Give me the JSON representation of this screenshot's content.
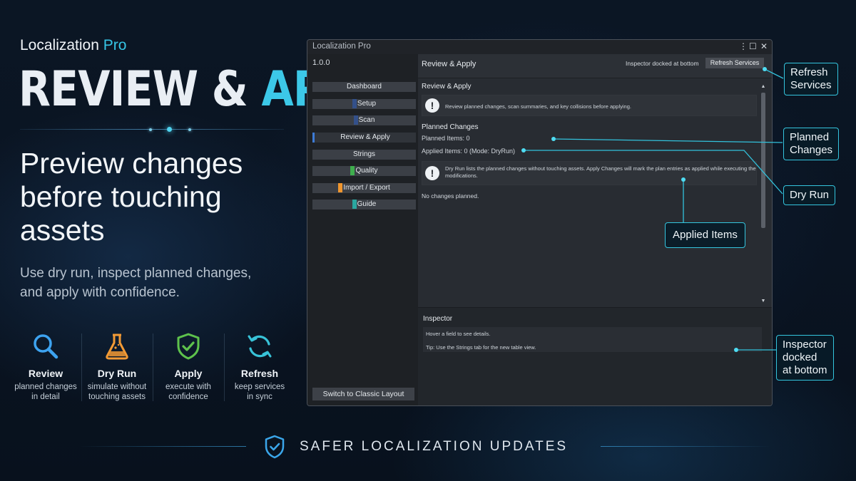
{
  "hero": {
    "brand_name": "Localization",
    "brand_accent": "Pro",
    "title_part1": "REVIEW &",
    "title_part2": "APPLY",
    "headline": "Preview changes before touching assets",
    "subline": "Use dry run, inspect planned changes, and apply with confidence."
  },
  "features": [
    {
      "icon": "magnifier-icon",
      "title": "Review",
      "desc1": "planned changes",
      "desc2": "in detail",
      "color": "#3da3f0"
    },
    {
      "icon": "flask-icon",
      "title": "Dry Run",
      "desc1": "simulate without",
      "desc2": "touching assets",
      "color": "#f29a35"
    },
    {
      "icon": "shield-check-icon",
      "title": "Apply",
      "desc1": "execute with",
      "desc2": "confidence",
      "color": "#5ec24c"
    },
    {
      "icon": "refresh-icon",
      "title": "Refresh",
      "desc1": "keep services",
      "desc2": "in sync",
      "color": "#38c3d8"
    }
  ],
  "footer": {
    "text": "SAFER LOCALIZATION UPDATES",
    "icon": "shield-check-icon"
  },
  "window": {
    "title": "Localization Pro",
    "controls": [
      "⋮",
      "☐",
      "✕"
    ],
    "version": "1.0.0",
    "nav": [
      {
        "label": "Dashboard",
        "marker": ""
      },
      {
        "label": "Setup",
        "marker": "#33508a"
      },
      {
        "label": "Scan",
        "marker": "#33508a"
      },
      {
        "label": "Review & Apply",
        "marker": "",
        "active": true
      },
      {
        "label": "Strings",
        "marker": ""
      },
      {
        "label": "Quality",
        "marker": "#3fae4e"
      },
      {
        "label": "Import / Export",
        "marker": "#f0962e"
      },
      {
        "label": "Guide",
        "marker": "#2aa7a0"
      }
    ],
    "classic_button": "Switch to Classic Layout",
    "header_title": "Review & Apply",
    "dock_note": "Inspector docked at bottom",
    "refresh_button": "Refresh Services",
    "section_title": "Review & Apply",
    "intro_message": "Review planned changes, scan summaries, and key collisions before applying.",
    "planned_title": "Planned Changes",
    "planned_items": "Planned Items: 0",
    "applied_items": "Applied Items: 0 (Mode: DryRun)",
    "dryrun_line1": "Dry Run lists the planned changes without touching assets. Apply Changes will mark the plan entries as applied while executing the",
    "dryrun_line2": "modifications.",
    "no_changes": "No changes planned.",
    "inspector_title": "Inspector",
    "inspector_hint": "Hover a field to see details.",
    "inspector_tip": "Tip: Use the Strings tab for the new table view."
  },
  "callouts": {
    "refresh": [
      "Refresh",
      "Services"
    ],
    "planned": [
      "Planned",
      "Changes"
    ],
    "dryrun": "Dry Run",
    "applied": "Applied Items",
    "inspector": [
      "Inspector",
      "docked",
      "at bottom"
    ]
  }
}
